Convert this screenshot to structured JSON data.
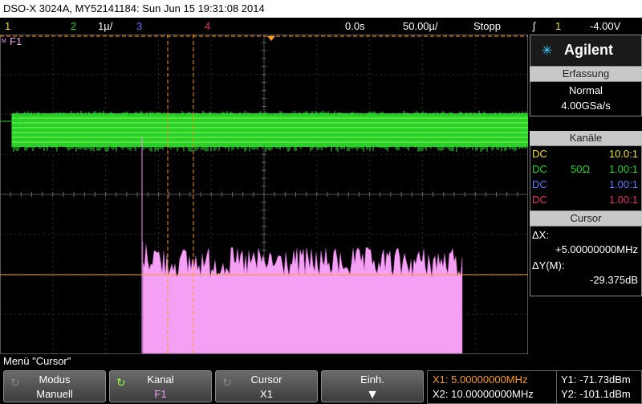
{
  "title_bar": {
    "text": "DSO-X 3024A, MY52141184: Sun Jun 15 19:31:08 2014"
  },
  "status_bar": {
    "ch1": "1",
    "ch2": "2",
    "ch3_scale": "1µ/",
    "ch3": "3",
    "ch4": "4",
    "delay": "0.0s",
    "timebase": "50.00µ/",
    "run_state": "Stopp",
    "trigger_icon": "trigger-edge-rising-icon",
    "trigger_source": "1",
    "trigger_level": "-4.00V",
    "colors": {
      "ch1": "#f2e21a",
      "ch2": "#22d82a",
      "ch3": "#5b7bff",
      "ch4": "#e8306a",
      "math": "#f4a0f4"
    }
  },
  "screen_labels": {
    "math_marker": "F1",
    "ch2_marker": "2"
  },
  "chart_data": {
    "type": "area",
    "title": "",
    "xlabel": "",
    "ylabel": "",
    "grid": true,
    "series": [
      {
        "name": "F1",
        "description_level_db": "-29.375"
      }
    ]
  },
  "panel": {
    "brand": "Agilent",
    "acquisition": {
      "header": "Erfassung",
      "mode": "Normal",
      "rate": "4.00GSa/s"
    },
    "channels": {
      "header": "Kanäle",
      "rows": [
        {
          "coupling": "DC",
          "impedance": "",
          "ratio": "10.0:1",
          "color": "#f2e21a"
        },
        {
          "coupling": "DC",
          "impedance": "50Ω",
          "ratio": "1.00:1",
          "color": "#22d82a"
        },
        {
          "coupling": "DC",
          "impedance": "",
          "ratio": "1.00:1",
          "color": "#5b7bff"
        },
        {
          "coupling": "DC",
          "impedance": "",
          "ratio": "1.00:1",
          "color": "#e8306a"
        }
      ]
    },
    "cursor": {
      "header": "Cursor",
      "dx_label": "ΔX:",
      "dx_value": "+5.00000000MHz",
      "dy_label": "ΔY(M):",
      "dy_value": "-29.375dB"
    }
  },
  "menu_title": "Menü \"Cursor\"",
  "softkeys": [
    {
      "line1": "Modus",
      "line2": "Manuell"
    },
    {
      "line1": "Kanal",
      "line2": "F1"
    },
    {
      "line1": "Cursor",
      "line2": "X1"
    },
    {
      "line1": "Einh.",
      "line2": ""
    }
  ],
  "cursor_readout": {
    "x1": "X1: 5.00000000MHz",
    "x2": "X2: 10.00000000MHz",
    "y1": "Y1: -71.73dBm",
    "y2": "Y2: -101.1dBm"
  }
}
